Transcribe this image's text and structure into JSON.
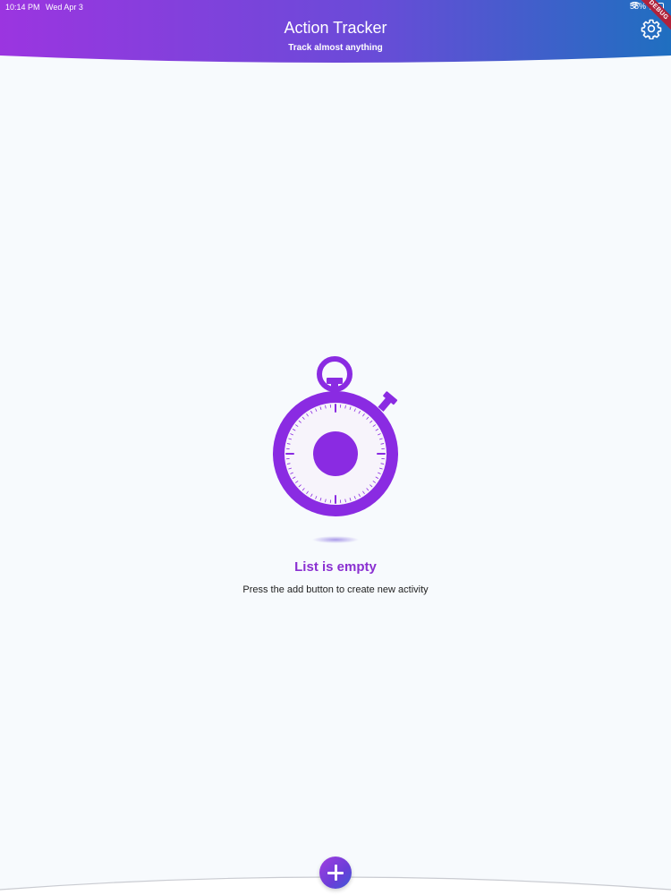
{
  "status_bar": {
    "time": "10:14 PM",
    "date": "Wed Apr 3",
    "battery": "55%",
    "debug_label": "DEBUG"
  },
  "header": {
    "title": "Action Tracker",
    "subtitle": "Track almost anything",
    "settings_icon": "gear-icon",
    "gradient_start": "#9b35e0",
    "gradient_end": "#1f6fc0"
  },
  "empty_state": {
    "icon": "stopwatch-icon",
    "title": "List is empty",
    "description": "Press the add button to create new activity",
    "accent_color": "#8a2be2"
  },
  "bottom_bar": {
    "add_icon": "plus-icon"
  }
}
